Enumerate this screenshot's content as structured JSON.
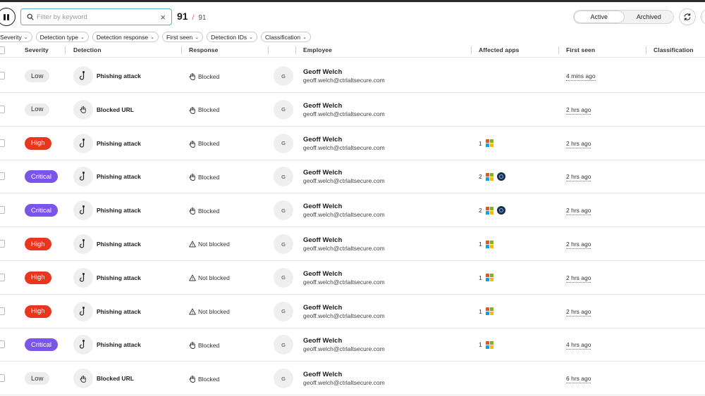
{
  "toolbar": {
    "search_placeholder": "Filter by keyword",
    "count_shown": "91",
    "count_sep": "/",
    "count_total": "91",
    "tabs": [
      {
        "label": "Active",
        "active": true
      },
      {
        "label": "Archived",
        "active": false
      }
    ]
  },
  "filters": [
    "Severity",
    "Detection type",
    "Detection response",
    "First seen",
    "Detection IDs",
    "Classification"
  ],
  "columns": {
    "severity": "Severity",
    "detection": "Detection",
    "response": "Response",
    "employee": "Employee",
    "affected_apps": "Affected apps",
    "first_seen": "First seen",
    "classification": "Classification"
  },
  "colors": {
    "low": "#ececec",
    "high": "#e8371e",
    "critical": "#7b55e8",
    "search_border": "#58b4c4"
  },
  "rows": [
    {
      "severity": "Low",
      "level": "low",
      "detection": "Phishing attack",
      "det_icon": "hook-icon",
      "response": "Blocked",
      "resp_icon": "hand-icon",
      "avatar": "G",
      "name": "Geoff Welch",
      "email": "geoff.welch@ctrlaltsecure.com",
      "apps_count": "",
      "apps": [],
      "seen": "4 mins ago"
    },
    {
      "severity": "Low",
      "level": "low",
      "detection": "Blocked URL",
      "det_icon": "hand-icon",
      "response": "Blocked",
      "resp_icon": "hand-icon",
      "avatar": "G",
      "name": "Geoff Welch",
      "email": "geoff.welch@ctrlaltsecure.com",
      "apps_count": "",
      "apps": [],
      "seen": "2 hrs ago"
    },
    {
      "severity": "High",
      "level": "high",
      "detection": "Phishing attack",
      "det_icon": "hook-icon",
      "response": "Blocked",
      "resp_icon": "hand-icon",
      "avatar": "G",
      "name": "Geoff Welch",
      "email": "geoff.welch@ctrlaltsecure.com",
      "apps_count": "1",
      "apps": [
        "microsoft-icon"
      ],
      "seen": "2 hrs ago"
    },
    {
      "severity": "Critical",
      "level": "critical",
      "detection": "Phishing attack",
      "det_icon": "hook-icon",
      "response": "Blocked",
      "resp_icon": "hand-icon",
      "avatar": "G",
      "name": "Geoff Welch",
      "email": "geoff.welch@ctrlaltsecure.com",
      "apps_count": "2",
      "apps": [
        "microsoft-icon",
        "circle-app-icon"
      ],
      "seen": "2 hrs ago"
    },
    {
      "severity": "Critical",
      "level": "critical",
      "detection": "Phishing attack",
      "det_icon": "hook-icon",
      "response": "Blocked",
      "resp_icon": "hand-icon",
      "avatar": "G",
      "name": "Geoff Welch",
      "email": "geoff.welch@ctrlaltsecure.com",
      "apps_count": "2",
      "apps": [
        "microsoft-icon",
        "circle-app-icon"
      ],
      "seen": "2 hrs ago"
    },
    {
      "severity": "High",
      "level": "high",
      "detection": "Phishing attack",
      "det_icon": "hook-icon",
      "response": "Not blocked",
      "resp_icon": "warning-icon",
      "avatar": "G",
      "name": "Geoff Welch",
      "email": "geoff.welch@ctrlaltsecure.com",
      "apps_count": "1",
      "apps": [
        "microsoft-icon"
      ],
      "seen": "2 hrs ago"
    },
    {
      "severity": "High",
      "level": "high",
      "detection": "Phishing attack",
      "det_icon": "hook-icon",
      "response": "Not blocked",
      "resp_icon": "warning-icon",
      "avatar": "G",
      "name": "Geoff Welch",
      "email": "geoff.welch@ctrlaltsecure.com",
      "apps_count": "1",
      "apps": [
        "microsoft-icon"
      ],
      "seen": "2 hrs ago"
    },
    {
      "severity": "High",
      "level": "high",
      "detection": "Phishing attack",
      "det_icon": "hook-icon",
      "response": "Not blocked",
      "resp_icon": "warning-icon",
      "avatar": "G",
      "name": "Geoff Welch",
      "email": "geoff.welch@ctrlaltsecure.com",
      "apps_count": "1",
      "apps": [
        "microsoft-icon"
      ],
      "seen": "2 hrs ago"
    },
    {
      "severity": "Critical",
      "level": "critical",
      "detection": "Phishing attack",
      "det_icon": "hook-icon",
      "response": "Blocked",
      "resp_icon": "hand-icon",
      "avatar": "G",
      "name": "Geoff Welch",
      "email": "geoff.welch@ctrlaltsecure.com",
      "apps_count": "1",
      "apps": [
        "microsoft-icon"
      ],
      "seen": "4 hrs ago"
    },
    {
      "severity": "Low",
      "level": "low",
      "detection": "Blocked URL",
      "det_icon": "hand-icon",
      "response": "Blocked",
      "resp_icon": "hand-icon",
      "avatar": "G",
      "name": "Geoff Welch",
      "email": "geoff.welch@ctrlaltsecure.com",
      "apps_count": "",
      "apps": [],
      "seen": "6 hrs ago"
    }
  ]
}
